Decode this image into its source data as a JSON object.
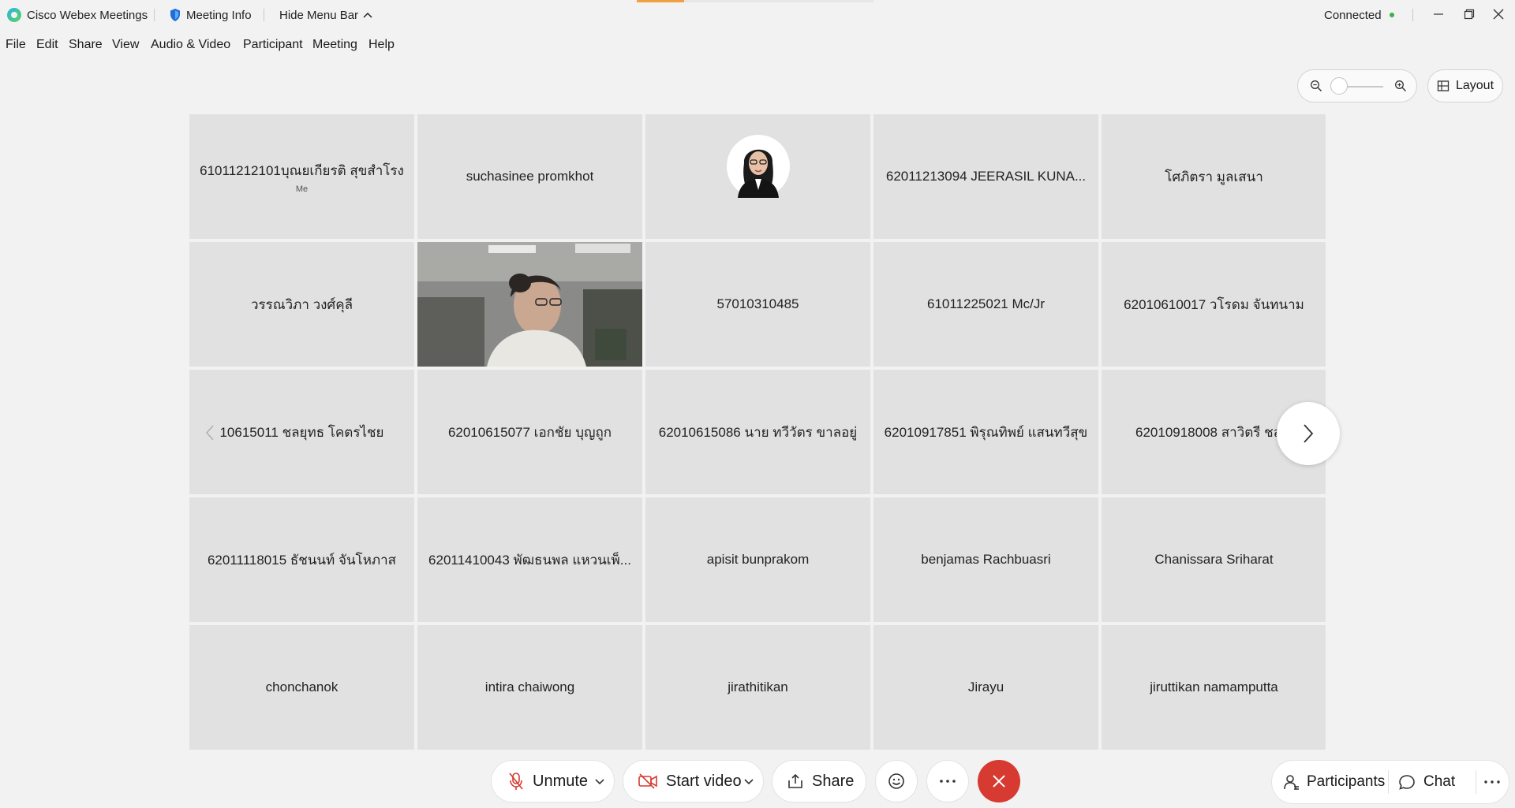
{
  "app": {
    "title": "Cisco Webex Meetings",
    "meeting_info": "Meeting Info",
    "hide_menu_bar": "Hide Menu Bar",
    "status": "Connected",
    "status_color": "#3cb043",
    "accent": "#d63a30"
  },
  "menu": [
    "File",
    "Edit",
    "Share",
    "View",
    "Audio & Video",
    "Participant",
    "Meeting",
    "Help"
  ],
  "view": {
    "layout_label": "Layout",
    "zoom_level": 0
  },
  "tiles": [
    {
      "name": "61011212101บุณยเกียรติ สุขสำโรง",
      "sub": "Me"
    },
    {
      "name": "suchasinee promkhot"
    },
    {
      "name": "",
      "kind": "avatar"
    },
    {
      "name": "62011213094 JEERASIL KUNA..."
    },
    {
      "name": "โศภิตรา มูลเสนา"
    },
    {
      "name": "วรรณวิภา วงศ์คุลี"
    },
    {
      "name": "",
      "kind": "video"
    },
    {
      "name": "57010310485"
    },
    {
      "name": "61011225021 Mc/Jr"
    },
    {
      "name": "62010610017 วโรดม จันทนาม"
    },
    {
      "name": "10615011 ชลยุทธ โคตรไชย"
    },
    {
      "name": "62010615077 เอกชัย บุญถูก"
    },
    {
      "name": "62010615086 นาย ทวีวัตร ขาลอยู่"
    },
    {
      "name": "62010917851 พิรุณทิพย์ แสนทวีสุข"
    },
    {
      "name": "62010918008 สาวิตรี ชลเพ"
    },
    {
      "name": "62011118015 ธัชนนท์ จันโหภาส"
    },
    {
      "name": "62011410043 พัฒธนพล แหวนเพ็..."
    },
    {
      "name": "apisit bunprakom"
    },
    {
      "name": "benjamas Rachbuasri"
    },
    {
      "name": "Chanissara Sriharat"
    },
    {
      "name": "chonchanok"
    },
    {
      "name": "intira chaiwong"
    },
    {
      "name": "jirathitikan"
    },
    {
      "name": "Jirayu"
    },
    {
      "name": "jiruttikan namamputta"
    }
  ],
  "controls": {
    "unmute": "Unmute",
    "start_video": "Start video",
    "share": "Share",
    "participants": "Participants",
    "chat": "Chat"
  }
}
